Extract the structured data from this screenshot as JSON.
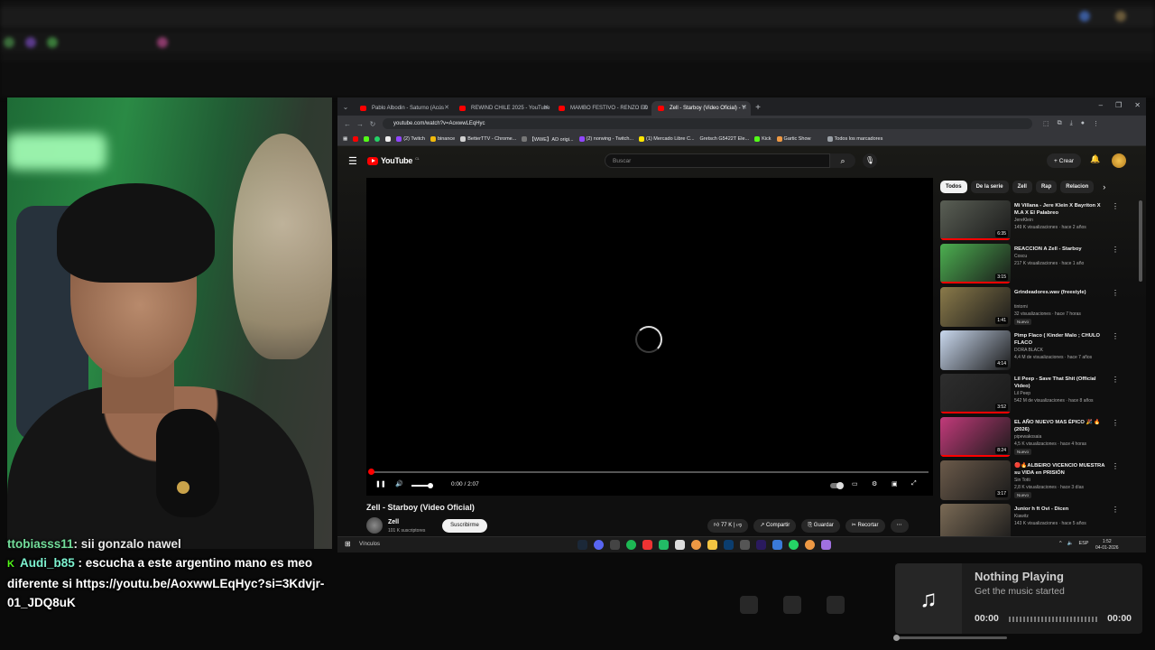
{
  "browser": {
    "tabs": [
      {
        "label": "Pablo Albo​din - Saturno (Acús"
      },
      {
        "label": "REWIND CHILE 2025 - YouTube"
      },
      {
        "label": "MAMBO FESTIVO - RENZO ED"
      },
      {
        "label": "Zell - Starboy (Video Oficial) - Y"
      }
    ],
    "url": "youtube.com/watch?v=AoxwwLEqHyc",
    "bookmarks": [
      "(2) Twitch",
      "binance",
      "BetterTTV - Chrome...",
      "【WWE】AD origi...",
      "(2) norwing - Twitch...",
      "(1) Mercado Libre C...",
      "Gretsch G5422T Ele...",
      "Kick",
      "Gartic Show"
    ],
    "all_bookmarks": "Todos los marcadores"
  },
  "youtube": {
    "logo": "YouTube",
    "logo_country": "CL",
    "search_placeholder": "Buscar",
    "create_label": "Crear",
    "video": {
      "time_current": "0:00",
      "time_total": "2:07",
      "time_display": "0:00 / 2:07",
      "progress": 0,
      "title": "Zell - Starboy (Video Oficial)",
      "channel": "Zell",
      "subscribers": "101 K suscriptores",
      "subscribe_label": "Suscribirme",
      "likes": "77 K",
      "share_label": "Compartir",
      "save_label": "Guardar",
      "clip_label": "Recortar"
    },
    "chips": [
      "Todos",
      "De la serie",
      "Zell",
      "Rap",
      "Relacion"
    ],
    "recommendations": [
      {
        "title": "Mi Villana - Jere Klein X Bayriton X M.A X El Palabreo",
        "channel": "JereKlein",
        "meta": "149 K visualizaciones · hace 2 años",
        "duration": "6:35",
        "badge": "",
        "thumb": "#5a5f55"
      },
      {
        "title": "REACCION A Zell - Starboy",
        "channel": "Coscu",
        "meta": "217 K visualizaciones · hace 1 año",
        "duration": "3:15",
        "badge": "",
        "thumb": "#4caf50"
      },
      {
        "title": "Grindeadores.wav  (freestyle)",
        "channel": "tintomi",
        "meta": "32 visualizaciones · hace 7 horas",
        "duration": "1:41",
        "badge": "Nuevo",
        "thumb": "#8a7a4a"
      },
      {
        "title": "Pimp Flaco ( Kinder Malo ; CHULO FLACO",
        "channel": "DORA BLACK",
        "meta": "4,4 M de visualizaciones · hace 7 años",
        "duration": "4:14",
        "badge": "",
        "thumb": "#c9d8ee"
      },
      {
        "title": "Lil Peep - Save That Shit (Official Video)",
        "channel": "Lil Peep",
        "meta": "542 M de visualizaciones · hace 8 años",
        "duration": "3:52",
        "badge": "",
        "thumb": "#2e2e2e"
      },
      {
        "title": "EL AÑO NUEVO MAS ÉPICO 🎉 🔥 (2026)",
        "channel": "pipewakosaia",
        "meta": "4,5 K visualizaciones · hace 4 horas",
        "duration": "8:24",
        "badge": "Nuevo",
        "thumb": "#c23a7a"
      },
      {
        "title": "🔴🔥ALBEIRO VICENCIO MUESTRA su VIDA en PRISIÓN",
        "channel": "Sin Totti",
        "meta": "2,8 K visualizaciones · hace 3 días",
        "duration": "3:17",
        "badge": "Nuevo",
        "thumb": "#6b5a4a"
      },
      {
        "title": "Junior h ft Ovi - Dicen",
        "channel": "Kiawitz",
        "meta": "143 K visualizaciones · hace 5 años",
        "duration": "",
        "badge": "",
        "thumb": "#7a6a55"
      }
    ]
  },
  "taskbar": {
    "links_label": "Vínculos",
    "lang": "ESP",
    "time": "1:52",
    "date": "04-01-2026"
  },
  "chat": [
    {
      "user": "ttobiasss11",
      "message": ": sii gonzalo nawel"
    },
    {
      "user": "Audi_b85",
      "message": ": escucha a este argentino mano es meo diferente si https://youtu.be/AoxwwLEqHyc?si=3Kdvjr-01_JDQ8uK"
    }
  ],
  "music_widget": {
    "title": "Nothing Playing",
    "subtitle": "Get the music started",
    "time_left": "00:00",
    "time_right": "00:00",
    "icon": "music-note-icon"
  },
  "colors": {
    "youtube_red": "#ff0000",
    "kick_green": "#53fc18",
    "chat_user": "#7df3a9"
  }
}
